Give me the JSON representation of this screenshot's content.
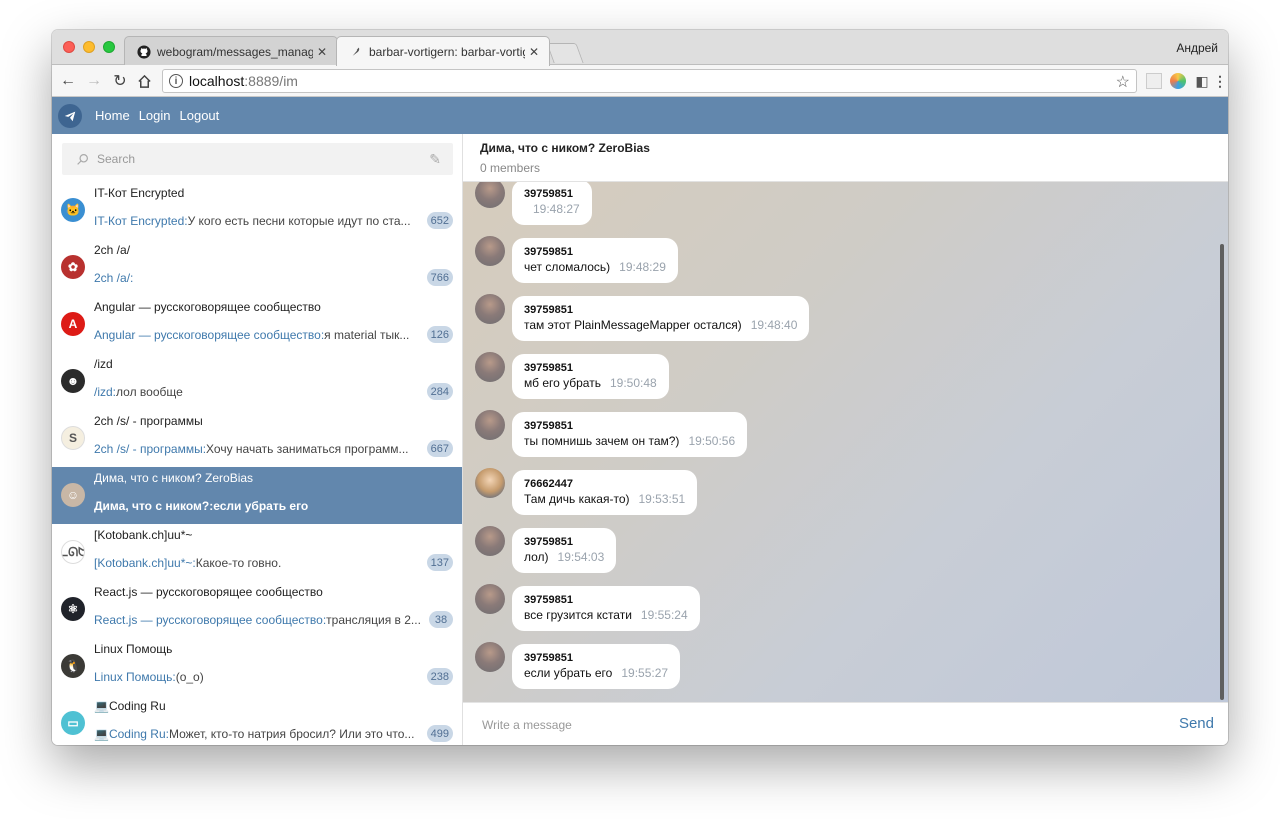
{
  "browser": {
    "tabs": [
      {
        "title": "webogram/messages_manage",
        "favicon": "github-icon",
        "active": false
      },
      {
        "title": "barbar-vortigern: barbar-vortig",
        "favicon": "feather-icon",
        "active": true
      }
    ],
    "profile_name": "Андрей",
    "url_host": "localhost",
    "url_rest": ":8889/im"
  },
  "app": {
    "nav": {
      "home": "Home",
      "login": "Login",
      "logout": "Logout"
    },
    "header_color": "#6287ad"
  },
  "sidebar": {
    "search_placeholder": "Search",
    "chats": [
      {
        "name": "IT-Кот Encrypted",
        "from": "IT-Кот Encrypted:",
        "text": "У кого есть песни которые идут по ста...",
        "badge": "652",
        "avatar_color": "#3a8fd2",
        "avatar_glyph": "🐱",
        "selected": false
      },
      {
        "name": "2ch /a/",
        "from": "2ch /a/:",
        "text": "",
        "badge": "766",
        "avatar_color": "#b8312f",
        "avatar_glyph": "✿",
        "selected": false
      },
      {
        "name": "Angular — русскоговорящее сообщество",
        "from": "Angular — русскоговорящее сообщество:",
        "text": "я material тык...",
        "badge": "126",
        "avatar_color": "#dd1b16",
        "avatar_glyph": "A",
        "selected": false
      },
      {
        "name": "/izd",
        "from": "/izd:",
        "text": "лол вообще",
        "badge": "284",
        "avatar_color": "#2b2b2b",
        "avatar_glyph": "☻",
        "selected": false
      },
      {
        "name": "2ch /s/ - программы",
        "from": "2ch /s/ - программы:",
        "text": "Хочу начать заниматься программ...",
        "badge": "667",
        "avatar_color": "#f5efe0",
        "avatar_glyph": "S",
        "selected": false
      },
      {
        "name": "Дима, что с ником? ZeroBias",
        "from": "Дима, что с ником?:",
        "text": "если убрать его",
        "badge": "",
        "avatar_color": "#c8b7a6",
        "avatar_glyph": "☺",
        "selected": true
      },
      {
        "name": "[Kotobank.ch]uu*~",
        "from": "[Kotobank.ch]uu*~:",
        "text": "Какое-то говно.",
        "badge": "137",
        "avatar_color": "#ffffff",
        "avatar_glyph": "ᓚᘏᗢ",
        "selected": false
      },
      {
        "name": "React.js — русскоговорящее сообщество",
        "from": "React.js — русскоговорящее сообщество:",
        "text": "трансляция в 2...",
        "badge": "38",
        "avatar_color": "#20232a",
        "avatar_glyph": "⚛",
        "selected": false
      },
      {
        "name": "Linux Помощь",
        "from": "Linux Помощь:",
        "text": "(o_o)",
        "badge": "238",
        "avatar_color": "#3b3a36",
        "avatar_glyph": "🐧",
        "selected": false
      },
      {
        "name": "💻Coding Ru",
        "from": "💻Coding Ru:",
        "text": "Может, кто-то натрия бросил? Или это что...",
        "badge": "499",
        "avatar_color": "#4fc1d3",
        "avatar_glyph": "▭",
        "selected": false
      }
    ]
  },
  "conversation": {
    "title": "Дима, что с ником? ZeroBias",
    "members": "0 members",
    "messages": [
      {
        "sender": "39759851",
        "text": "",
        "time": "19:48:27"
      },
      {
        "sender": "39759851",
        "text": "чет сломалось)",
        "time": "19:48:29"
      },
      {
        "sender": "39759851",
        "text": "там этот PlainMessageMapper остался)",
        "time": "19:48:40"
      },
      {
        "sender": "39759851",
        "text": "мб его убрать",
        "time": "19:50:48"
      },
      {
        "sender": "39759851",
        "text": "ты помнишь зачем он там?)",
        "time": "19:50:56"
      },
      {
        "sender": "76662447",
        "text": "Там дичь какая-то)",
        "time": "19:53:51"
      },
      {
        "sender": "39759851",
        "text": "лол)",
        "time": "19:54:03"
      },
      {
        "sender": "39759851",
        "text": "все грузится кстати",
        "time": "19:55:24"
      },
      {
        "sender": "39759851",
        "text": "если убрать его",
        "time": "19:55:27"
      }
    ],
    "composer_placeholder": "Write a message",
    "send_label": "Send"
  }
}
